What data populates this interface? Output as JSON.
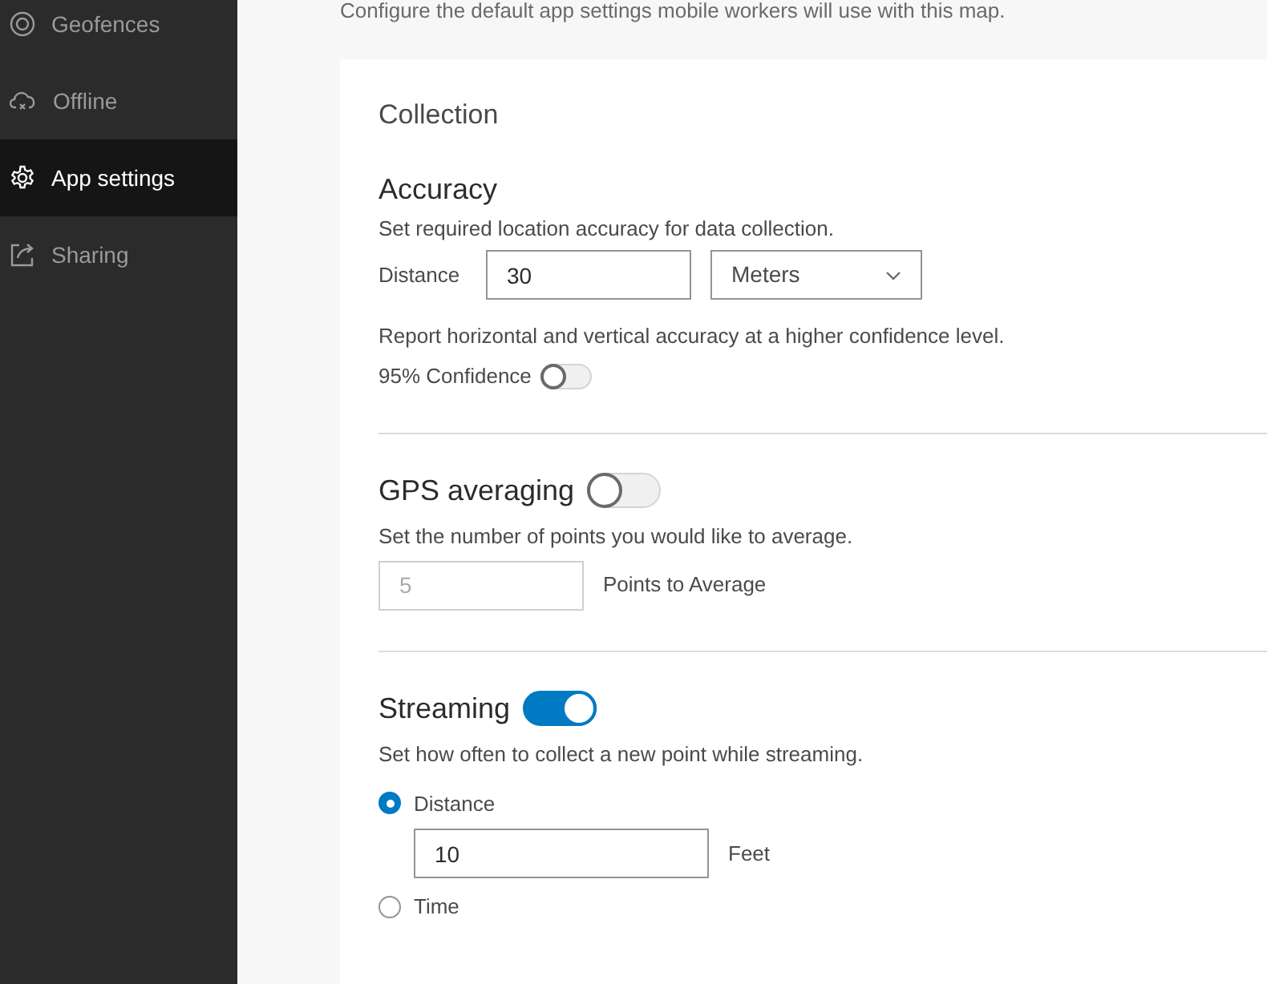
{
  "header": {
    "description": "Configure the default app settings mobile workers will use with this map."
  },
  "sidebar": {
    "items": [
      {
        "label": "Geofences",
        "selected": false
      },
      {
        "label": "Offline",
        "selected": false
      },
      {
        "label": "App settings",
        "selected": true
      },
      {
        "label": "Sharing",
        "selected": false
      }
    ]
  },
  "card": {
    "title": "Collection",
    "sections": [
      {
        "kind": "accuracy",
        "title": "Accuracy",
        "description": "Set required location accuracy for data collection.",
        "distance_label": "Distance",
        "distance_value": "30",
        "unit": "Meters",
        "confidence_description": "Report horizontal and vertical accuracy at a higher confidence level.",
        "confidence_label": "95% Confidence",
        "confidence_on": false
      },
      {
        "kind": "averaging",
        "title": "GPS averaging",
        "on": false,
        "description": "Set the number of points you would like to average.",
        "points_value": "5",
        "points_disabled": true,
        "points_label": "Points to Average"
      },
      {
        "kind": "streaming",
        "title": "Streaming",
        "on": true,
        "description": "Set how often to collect a new point while streaming.",
        "options": [
          {
            "label": "Distance",
            "selected": true,
            "value": "10",
            "unit": "Feet"
          },
          {
            "label": "Time",
            "selected": false
          }
        ]
      }
    ]
  }
}
